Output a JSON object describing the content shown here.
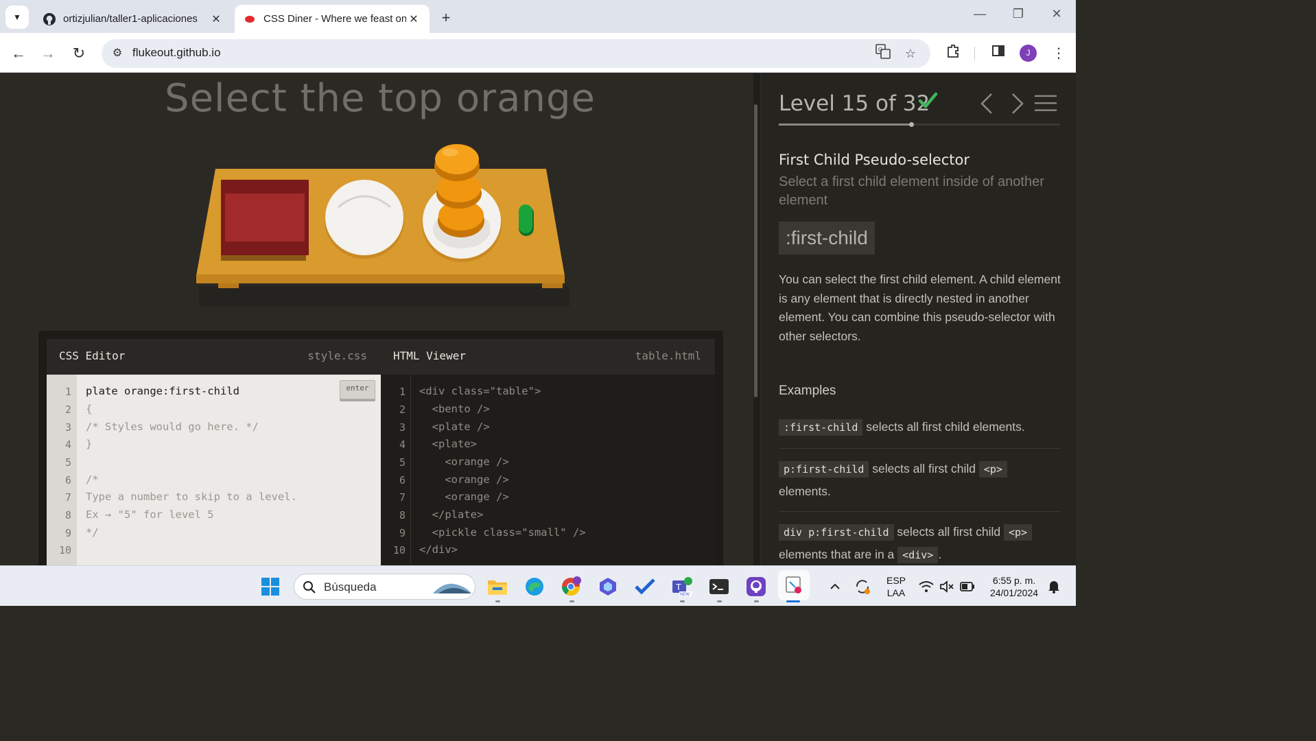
{
  "browser": {
    "tabs": [
      {
        "title": "ortizjulian/taller1-aplicaciones",
        "icon": "github-icon",
        "active": false
      },
      {
        "title": "CSS Diner - Where we feast on CSS",
        "icon": "css-diner-icon",
        "active": true
      }
    ],
    "new_tab_label": "+",
    "url": "flukeout.github.io",
    "profile_initial": "J"
  },
  "game": {
    "instruction": "Select the top orange",
    "css_editor": {
      "title": "CSS Editor",
      "file": "style.css",
      "enter_label": "enter",
      "input": "plate orange:first-child",
      "lines": [
        "{",
        "/* Styles would go here. */",
        "}",
        "",
        "/*",
        "Type a number to skip to a level.",
        "Ex → \"5\" for level 5",
        "*/",
        ""
      ],
      "line_numbers": [
        "1",
        "2",
        "3",
        "4",
        "5",
        "6",
        "7",
        "8",
        "9",
        "10"
      ]
    },
    "html_viewer": {
      "title": "HTML Viewer",
      "file": "table.html",
      "lines": [
        "<div class=\"table\">",
        "  <bento />",
        "  <plate />",
        "  <plate>",
        "    <orange />",
        "    <orange />",
        "    <orange />",
        "  </plate>",
        "  <pickle class=\"small\" />",
        "</div>"
      ],
      "line_numbers": [
        "1",
        "2",
        "3",
        "4",
        "5",
        "6",
        "7",
        "8",
        "9",
        "10"
      ]
    }
  },
  "sidebar": {
    "level": "Level 15 of 32",
    "level_progress": 0.47,
    "completed": true,
    "heading": "First Child Pseudo-selector",
    "subheading": "Select a first child element inside of another element",
    "syntax": ":first-child",
    "hint": "You can select the first child element. A child element is any element that is directly nested in another element. You can combine this pseudo-selector with other selectors.",
    "examples_title": "Examples",
    "examples": [
      {
        "code": ":first-child",
        "text": " selects all first child elements."
      },
      {
        "code": "p:first-child",
        "text": " selects all first child ",
        "code2": "<p>",
        "text2": " elements."
      },
      {
        "code": "div p:first-child",
        "text": " selects all first child ",
        "code2": "<p>",
        "text2": " elements that are in a ",
        "code3": "<div>",
        "text3": "."
      }
    ]
  },
  "taskbar": {
    "search_label": "Búsqueda",
    "language": "ESP",
    "layout": "LAA",
    "time": "6:55 p. m.",
    "date": "24/01/2024"
  },
  "colors": {
    "page_bg": "#2b2924",
    "table_wood": "#d99a2e",
    "orange": "#f0960f",
    "pickle": "#1aa33a",
    "bento": "#a32a2a",
    "check": "#3fb65a"
  }
}
